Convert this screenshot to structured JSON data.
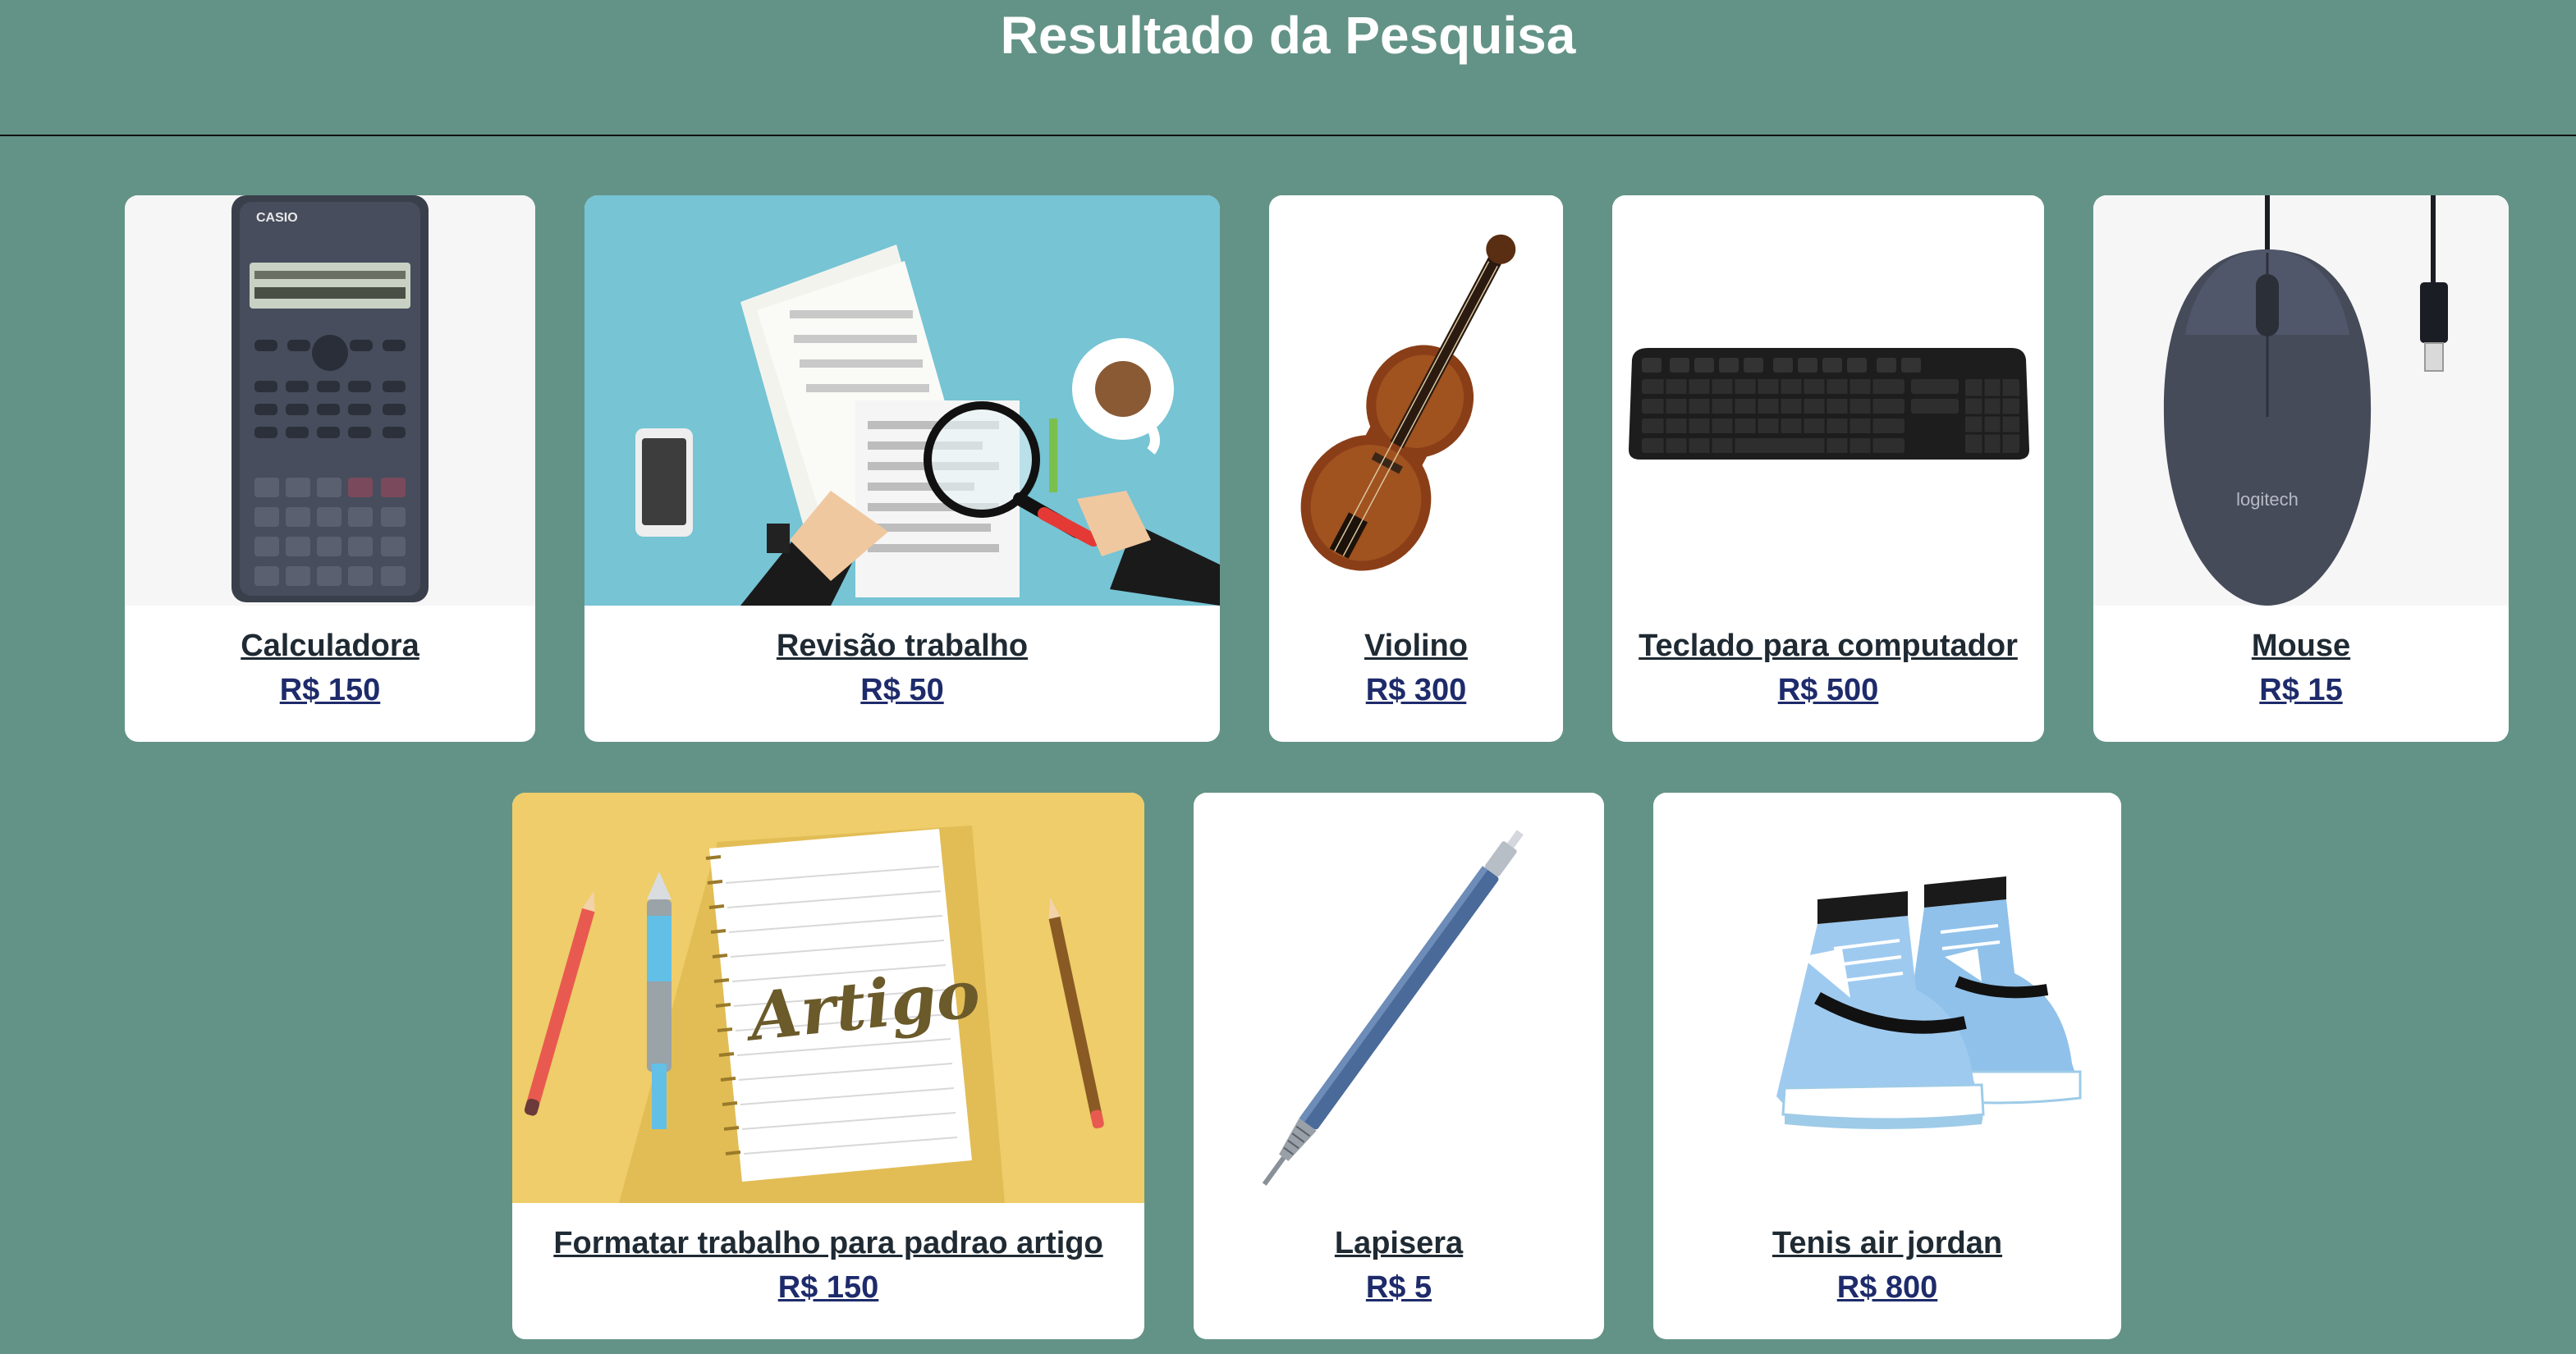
{
  "header": {
    "title": "Resultado da Pesquisa"
  },
  "image_text": {
    "calculator_brand": "CASIO",
    "mouse_brand": "logitech",
    "notebook_word": "Artigo"
  },
  "products": [
    {
      "name": "Calculadora",
      "price": "R$ 150",
      "icon": "calculator-image"
    },
    {
      "name": "Revisão trabalho",
      "price": "R$ 50",
      "icon": "document-review-image"
    },
    {
      "name": "Violino",
      "price": "R$ 300",
      "icon": "violin-image"
    },
    {
      "name": "Teclado para computador",
      "price": "R$ 500",
      "icon": "keyboard-image"
    },
    {
      "name": "Mouse",
      "price": "R$ 15",
      "icon": "mouse-image"
    },
    {
      "name": "Formatar trabalho para padrao artigo",
      "price": "R$ 150",
      "icon": "article-format-image"
    },
    {
      "name": "Lapisera",
      "price": "R$ 5",
      "icon": "mechanical-pencil-image"
    },
    {
      "name": "Tenis air jordan",
      "price": "R$ 800",
      "icon": "sneaker-image"
    }
  ],
  "colors": {
    "background": "#639386",
    "card": "#ffffff",
    "title": "#ffffff",
    "product_name": "#1f2a33",
    "price": "#1e2b6b"
  }
}
